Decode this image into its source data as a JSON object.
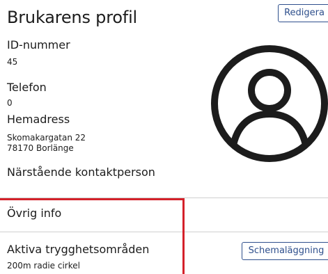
{
  "header": {
    "title": "Brukarens profil",
    "edit_label": "Redigera"
  },
  "profile": {
    "id_label": "ID-nummer",
    "id_value": "45",
    "phone_label": "Telefon",
    "phone_value": "0",
    "address_label": "Hemadress",
    "address_line1": "Skomakargatan 22",
    "address_line2": "78170 Borlänge",
    "relative_label": "Närstående kontaktperson"
  },
  "other_info": {
    "label": "Övrig info"
  },
  "safety_zones": {
    "label": "Aktiva trygghetsområden",
    "value": "200m radie cirkel",
    "schedule_label": "Schemaläggning"
  },
  "avatar": {
    "icon": "user-avatar-icon"
  },
  "colors": {
    "accent": "#2e4f8c",
    "highlight": "#d4212a",
    "text": "#1c1c1c",
    "divider": "#cfcfcf"
  }
}
